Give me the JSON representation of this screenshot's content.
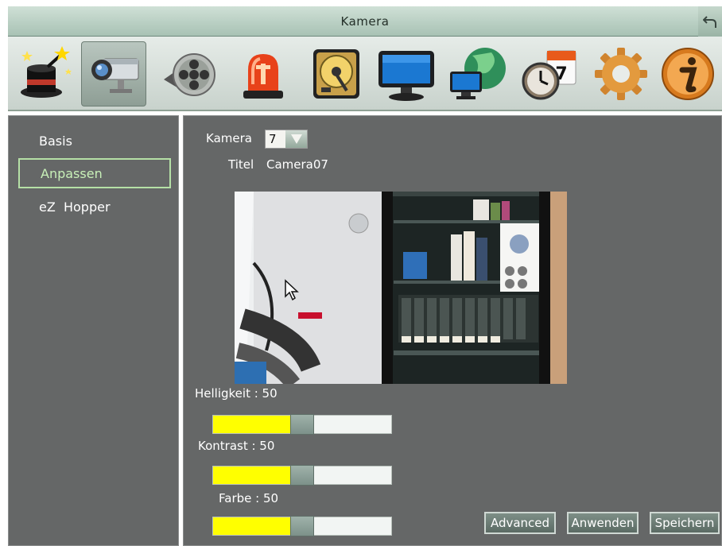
{
  "window": {
    "title": "Kamera"
  },
  "toolbar": {
    "icons": [
      "wizard-icon",
      "camera-icon",
      "recording-reel-icon",
      "alarm-light-icon",
      "hard-disk-icon",
      "monitor-icon",
      "network-icon",
      "schedule-icon",
      "gear-icon",
      "info-icon"
    ],
    "selected": "camera-icon"
  },
  "sidebar": {
    "items": [
      {
        "label": "Basis"
      },
      {
        "label": "Anpassen",
        "active": true
      },
      {
        "label": "eZ  Hopper"
      }
    ]
  },
  "main": {
    "camera_label": "Kamera",
    "camera_value": "7",
    "title_label": "Titel",
    "title_value": "Camera07",
    "brightness": {
      "label": "Helligkeit  :  50",
      "value": 50,
      "max": 100
    },
    "contrast": {
      "label": "Kontrast  :  50",
      "value": 50,
      "max": 100
    },
    "color": {
      "label": "Farbe  :  50",
      "value": 50,
      "max": 100
    }
  },
  "buttons": {
    "advanced": "Advanced",
    "apply": "Anwenden",
    "save": "Speichern"
  },
  "colors": {
    "panel_bg": "#656767",
    "slider_fill": "#ffff00",
    "active_border": "#b5e0a6"
  }
}
